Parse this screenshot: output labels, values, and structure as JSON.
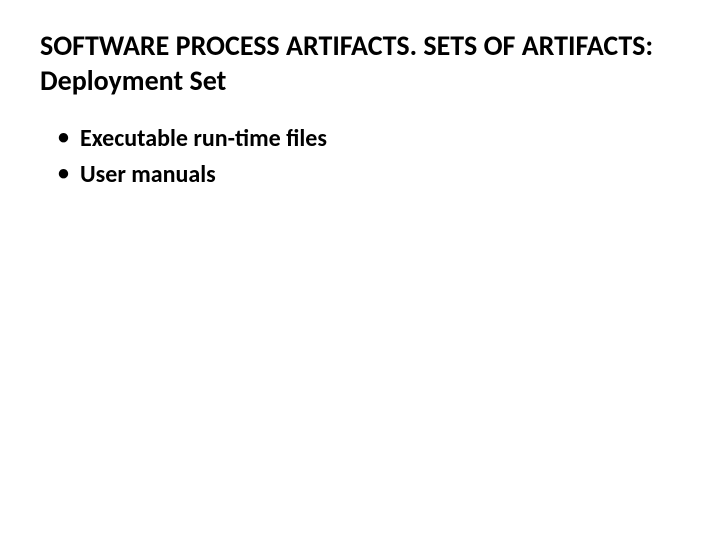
{
  "title": "SOFTWARE PROCESS ARTIFACTS. SETS OF ARTIFACTS: Deployment Set",
  "bullets": {
    "item0": "Executable run-time files",
    "item1": "User manuals"
  }
}
